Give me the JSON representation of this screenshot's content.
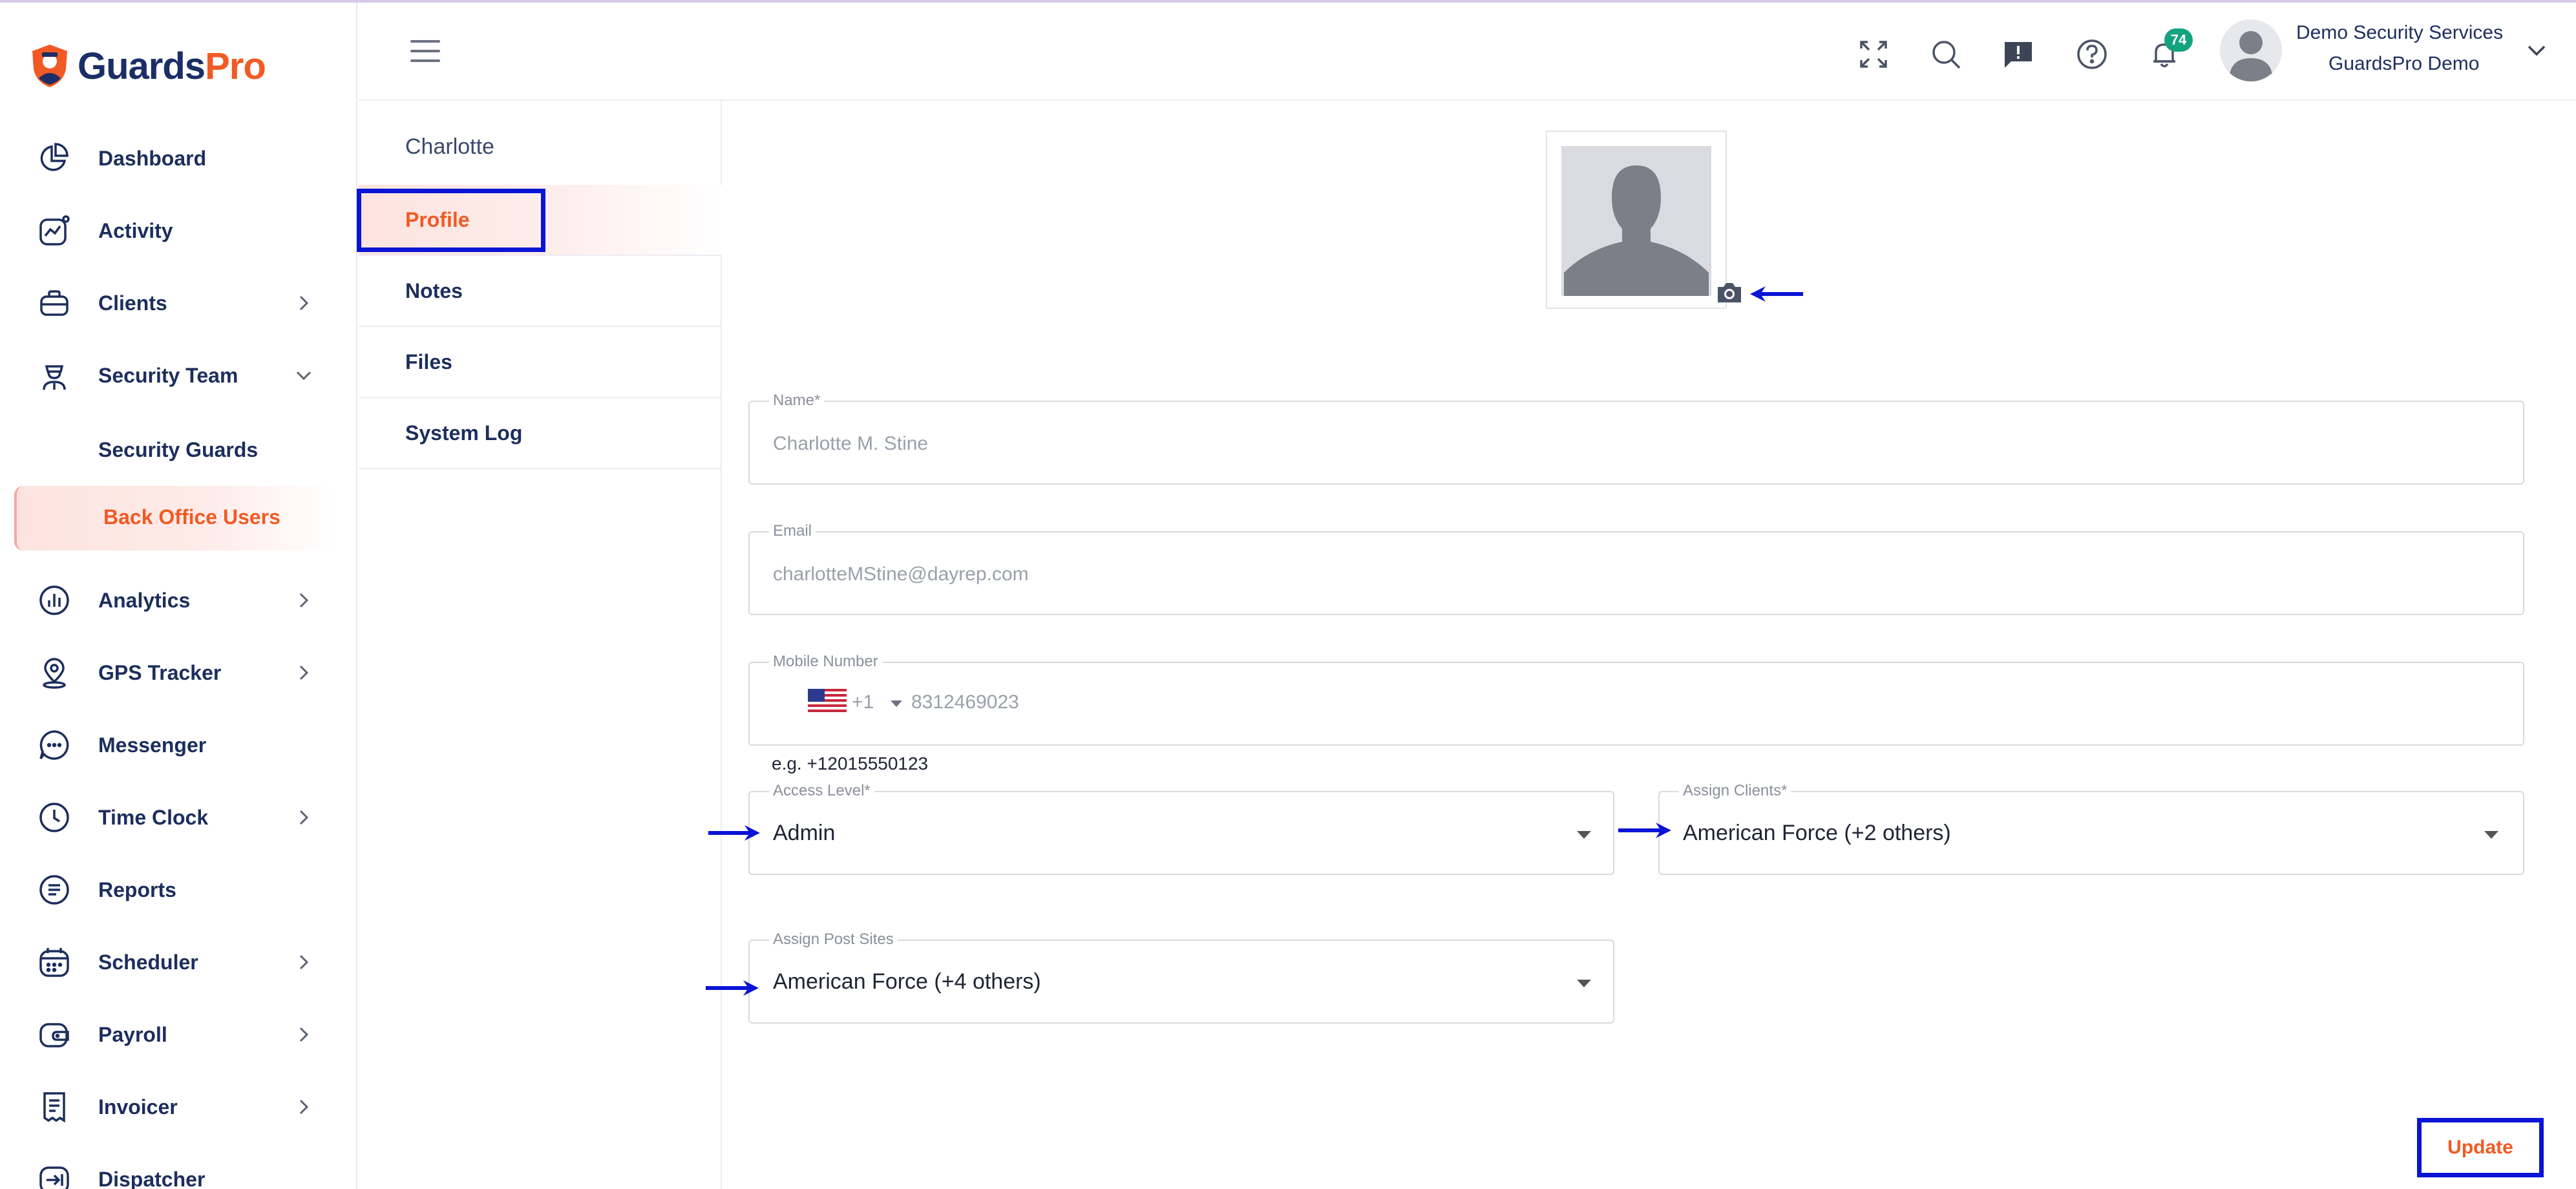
{
  "app": {
    "logo_part1": "Guards",
    "logo_part2": "Pro",
    "brand_navy": "#1c2e66",
    "brand_orange": "#f15a24",
    "highlight_blue": "#0a14d6"
  },
  "sidebar": {
    "items": [
      {
        "label": "Dashboard",
        "icon": "pie-chart-icon",
        "has_chevron": false
      },
      {
        "label": "Activity",
        "icon": "activity-icon",
        "has_chevron": false
      },
      {
        "label": "Clients",
        "icon": "briefcase-icon",
        "has_chevron": true
      },
      {
        "label": "Security Team",
        "icon": "guard-icon",
        "has_chevron": true,
        "expanded": true
      },
      {
        "label": "Analytics",
        "icon": "analytics-icon",
        "has_chevron": true
      },
      {
        "label": "GPS Tracker",
        "icon": "location-pin-icon",
        "has_chevron": true
      },
      {
        "label": "Messenger",
        "icon": "chat-bubble-icon",
        "has_chevron": false
      },
      {
        "label": "Time Clock",
        "icon": "clock-icon",
        "has_chevron": true
      },
      {
        "label": "Reports",
        "icon": "document-icon",
        "has_chevron": false
      },
      {
        "label": "Scheduler",
        "icon": "calendar-icon",
        "has_chevron": true
      },
      {
        "label": "Payroll",
        "icon": "wallet-icon",
        "has_chevron": true
      },
      {
        "label": "Invoicer",
        "icon": "receipt-icon",
        "has_chevron": true
      },
      {
        "label": "Dispatcher",
        "icon": "dispatch-icon",
        "has_chevron": false
      }
    ],
    "sub_items": [
      {
        "label": "Security Guards"
      },
      {
        "label": "Back Office Users",
        "active": true
      }
    ]
  },
  "header": {
    "icons": [
      "fullscreen-icon",
      "search-icon",
      "feedback-icon",
      "help-icon",
      "bell-icon"
    ],
    "notification_count": "74",
    "user_name": "Demo Security Services",
    "user_org": "GuardsPro Demo"
  },
  "subnav": {
    "title": "Charlotte",
    "items": [
      {
        "label": "Profile",
        "active": true
      },
      {
        "label": "Notes"
      },
      {
        "label": "Files"
      },
      {
        "label": "System Log"
      }
    ]
  },
  "form": {
    "name": {
      "label": "Name*",
      "value": "Charlotte M. Stine"
    },
    "email": {
      "label": "Email",
      "value": "charlotteMStine@dayrep.com"
    },
    "mobile": {
      "label": "Mobile Number",
      "country_code": "+1",
      "value": "8312469023",
      "hint": "e.g. +12015550123"
    },
    "access_level": {
      "label": "Access Level*",
      "value": "Admin"
    },
    "assign_clients": {
      "label": "Assign Clients*",
      "value": "American Force (+2 others)"
    },
    "assign_post_sites": {
      "label": "Assign Post Sites",
      "value": "American Force (+4 others)"
    },
    "update_label": "Update"
  }
}
